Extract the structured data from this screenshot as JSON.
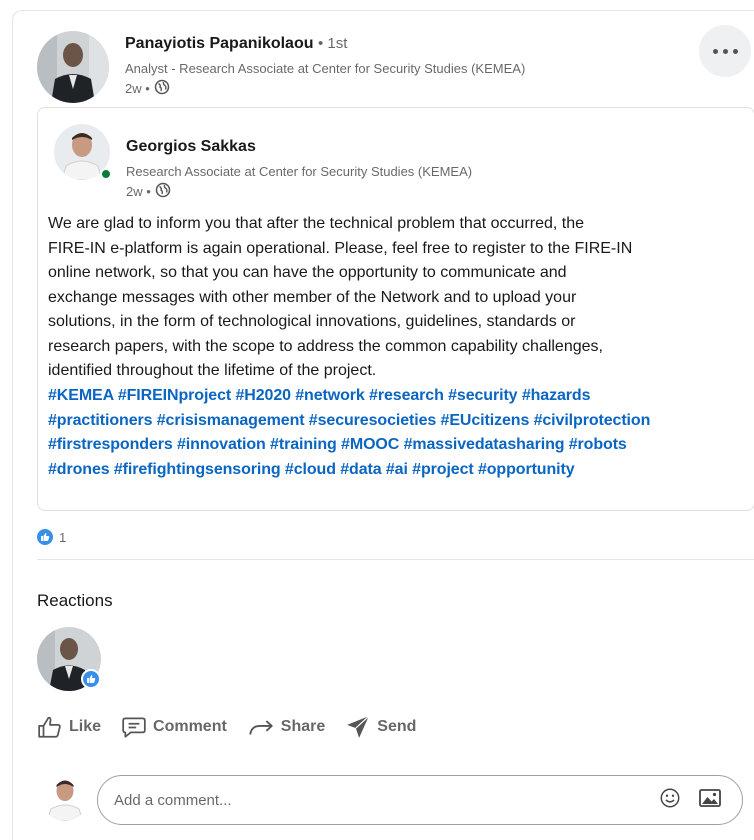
{
  "post": {
    "actor": {
      "name": "Panayiotis Papanikolaou",
      "degree": "• 1st",
      "headline": "Analyst - Research Associate at Center for Security Studies (KEMEA)",
      "time": "2w •"
    },
    "shared": {
      "name": "Georgios Sakkas",
      "headline": "Research Associate at Center for Security Studies (KEMEA)",
      "time": "2w •",
      "text_lines": [
        "We are glad to inform you that after the technical problem that occurred, the",
        "FIRE-IN e-platform is again operational. Please, feel free to register to the FIRE-IN",
        "online network, so that you can have the opportunity to communicate and",
        "exchange messages with other member of the Network and to upload your",
        "solutions, in the form of technological innovations, guidelines, standards or",
        "research papers, with the scope to address the common capability challenges,",
        "identified throughout the lifetime of the project."
      ],
      "hashtag_lines": [
        "#KEMEA #FIREINproject #H2020 #network #research #security #hazards",
        "#practitioners #crisismanagement #securesocieties #EUcitizens #civilprotection",
        "#firstresponders #innovation #training #MOOC #massivedatasharing #robots",
        "#drones #firefightingsensoring #cloud #data #ai #project #opportunity"
      ]
    },
    "reaction_count": "1"
  },
  "reactions": {
    "title": "Reactions"
  },
  "actions": {
    "like": "Like",
    "comment": "Comment",
    "share": "Share",
    "send": "Send"
  },
  "comment_box": {
    "placeholder": "Add a comment..."
  },
  "colors": {
    "link_blue": "#0a66c2",
    "like_blue": "#378fe9",
    "online_green": "#0a7b36"
  }
}
